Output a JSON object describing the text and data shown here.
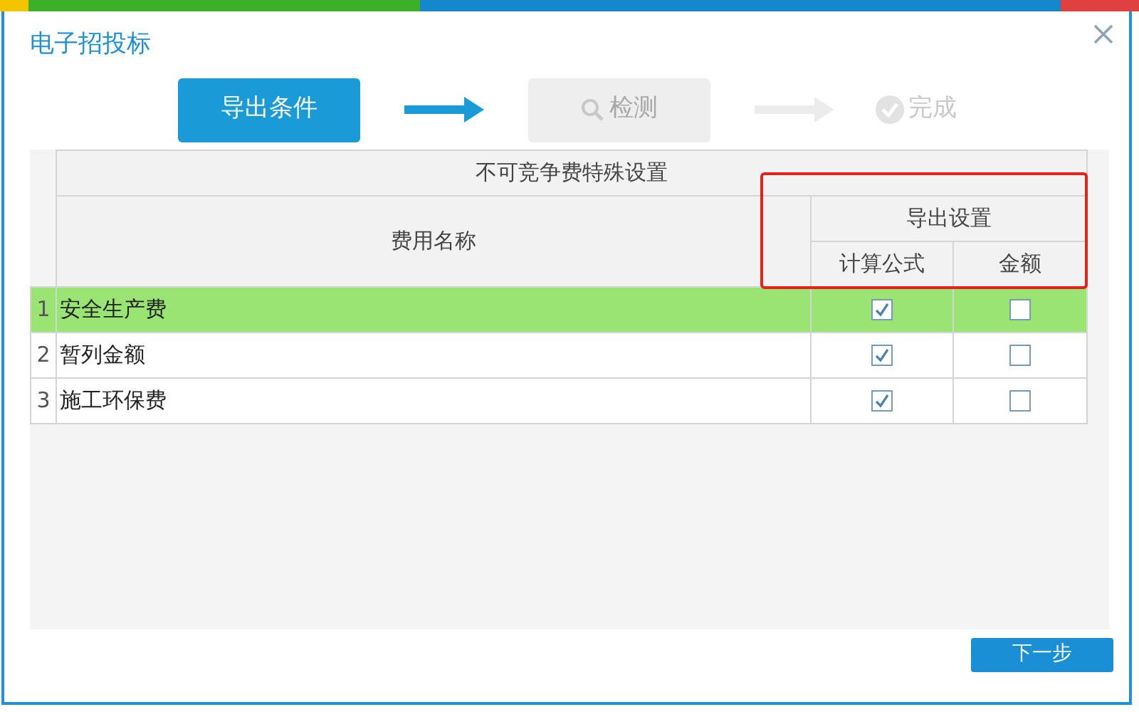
{
  "window": {
    "title": "电子招投标"
  },
  "steps": [
    {
      "label": "导出条件",
      "kind": "plain",
      "active": true
    },
    {
      "label": "检测",
      "kind": "search",
      "active": false
    },
    {
      "label": "完成",
      "kind": "check",
      "active": false
    }
  ],
  "table": {
    "title": "不可竞争费特殊设置",
    "name_header": "费用名称",
    "group_header": "导出设置",
    "columns": [
      "计算公式",
      "金额"
    ],
    "rows": [
      {
        "index": "1",
        "name": "安全生产费",
        "selected": true,
        "checks": [
          true,
          false
        ]
      },
      {
        "index": "2",
        "name": "暂列金额",
        "selected": false,
        "checks": [
          true,
          false
        ]
      },
      {
        "index": "3",
        "name": "施工环保费",
        "selected": false,
        "checks": [
          true,
          false
        ]
      }
    ]
  },
  "footer": {
    "button": "下一步"
  }
}
